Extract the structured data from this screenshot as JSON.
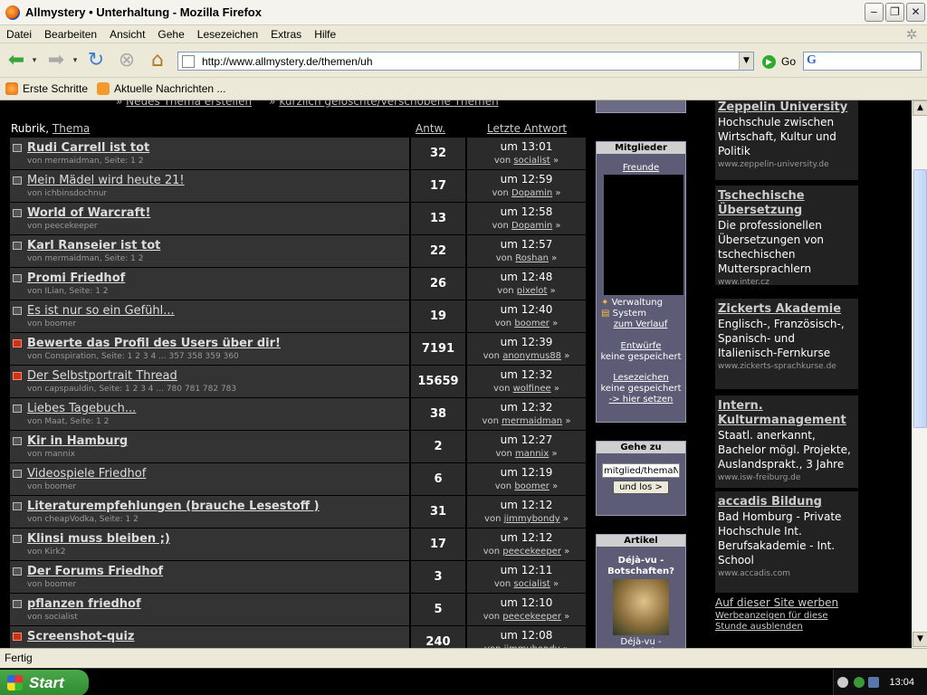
{
  "window": {
    "title": "Allmystery • Unterhaltung - Mozilla Firefox"
  },
  "menu": [
    "Datei",
    "Bearbeiten",
    "Ansicht",
    "Gehe",
    "Lesezeichen",
    "Extras",
    "Hilfe"
  ],
  "nav": {
    "url": "http://www.allmystery.de/themen/uh",
    "go_label": "Go"
  },
  "bookmarks": [
    {
      "label": "Erste Schritte",
      "color": "#e26a12"
    },
    {
      "label": "Aktuelle Nachrichten ...",
      "color": "#f29a2e"
    }
  ],
  "forum": {
    "top_links": {
      "new_topic": "Neues Thema erstellen",
      "deleted": "kürzlich gelöschte/verschobene Themen"
    },
    "header": {
      "rubrik": "Rubrik,",
      "thema": "Thema",
      "antw": "Antw.",
      "last": "Letzte Antwort"
    },
    "threads": [
      {
        "title": "Rudi Carrell ist tot",
        "bold": true,
        "hot": false,
        "sub": "von mermaidman, Seite: 1 2",
        "replies": "32",
        "time": "um 13:01",
        "by": "von",
        "user": "socialist",
        "arrow": "»"
      },
      {
        "title": "Mein Mädel wird heute 21!",
        "bold": false,
        "hot": false,
        "sub": "von ichbinsdochnur",
        "replies": "17",
        "time": "um 12:59",
        "by": "von",
        "user": "Dopamin",
        "arrow": "»"
      },
      {
        "title": "World of Warcraft!",
        "bold": true,
        "hot": false,
        "sub": "von peecekeeper",
        "replies": "13",
        "time": "um 12:58",
        "by": "von",
        "user": "Dopamin",
        "arrow": "»"
      },
      {
        "title": "Karl Ranseier ist tot",
        "bold": true,
        "hot": false,
        "sub": "von mermaidman, Seite: 1 2",
        "replies": "22",
        "time": "um 12:57",
        "by": "von",
        "user": "Roshan",
        "arrow": "»"
      },
      {
        "title": "Promi Friedhof",
        "bold": true,
        "hot": false,
        "sub": "von ILian, Seite: 1 2",
        "replies": "26",
        "time": "um 12:48",
        "by": "von",
        "user": "pixelot",
        "arrow": "»"
      },
      {
        "title": "Es ist nur so ein Gefühl...",
        "bold": false,
        "hot": false,
        "sub": "von boomer",
        "replies": "19",
        "time": "um 12:40",
        "by": "von",
        "user": "boomer",
        "arrow": "»"
      },
      {
        "title": "Bewerte das Profil des Users über dir!",
        "bold": true,
        "hot": true,
        "sub": "von Conspiration, Seite: 1 2 3 4 ... 357 358 359 360",
        "replies": "7191",
        "time": "um 12:39",
        "by": "von",
        "user": "anonymus88",
        "arrow": "»"
      },
      {
        "title": "Der Selbstportrait Thread",
        "bold": false,
        "hot": true,
        "sub": "von capspauldin, Seite: 1 2 3 4 ... 780 781 782 783",
        "replies": "15659",
        "time": "um 12:32",
        "by": "von",
        "user": "wolfinee",
        "arrow": "»"
      },
      {
        "title": "Liebes Tagebuch...",
        "bold": false,
        "hot": false,
        "sub": "von Maat, Seite: 1 2",
        "replies": "38",
        "time": "um 12:32",
        "by": "von",
        "user": "mermaidman",
        "arrow": "»"
      },
      {
        "title": "Kir in Hamburg",
        "bold": true,
        "hot": false,
        "sub": "von mannix",
        "replies": "2",
        "time": "um 12:27",
        "by": "von",
        "user": "mannix",
        "arrow": "»"
      },
      {
        "title": "Videospiele Friedhof",
        "bold": false,
        "hot": false,
        "sub": "von boomer",
        "replies": "6",
        "time": "um 12:19",
        "by": "von",
        "user": "boomer",
        "arrow": "»"
      },
      {
        "title": "Literaturempfehlungen (brauche Lesestoff )",
        "bold": true,
        "hot": false,
        "sub": "von cheapVodka, Seite: 1 2",
        "replies": "31",
        "time": "um 12:12",
        "by": "von",
        "user": "jimmybondy",
        "arrow": "»"
      },
      {
        "title": "Klinsi muss bleiben ;)",
        "bold": true,
        "hot": false,
        "sub": "von Kirk2",
        "replies": "17",
        "time": "um 12:12",
        "by": "von",
        "user": "peecekeeper",
        "arrow": "»"
      },
      {
        "title": "Der Forums Friedhof",
        "bold": true,
        "hot": false,
        "sub": "von boomer",
        "replies": "3",
        "time": "um 12:11",
        "by": "von",
        "user": "socialist",
        "arrow": "»"
      },
      {
        "title": "pflanzen friedhof",
        "bold": true,
        "hot": false,
        "sub": "von socialist",
        "replies": "5",
        "time": "um 12:10",
        "by": "von",
        "user": "peecekeeper",
        "arrow": "»"
      },
      {
        "title": "Screenshot-quiz",
        "bold": true,
        "hot": true,
        "sub": "",
        "replies": "240",
        "time": "um 12:08",
        "by": "von",
        "user": "jimmybondy",
        "arrow": "»"
      }
    ]
  },
  "sidebar": {
    "mitglieder": {
      "title": "Mitglieder",
      "freunde": "Freunde",
      "verwaltung": "Verwaltung",
      "system": "System",
      "verlauf": "zum Verlauf",
      "entwuerfe": "Entwürfe",
      "entwuerfe_status": "keine gespeichert",
      "lesezeichen": "Lesezeichen",
      "lesezeichen_status": "keine gespeichert",
      "setzen": "-> hier setzen"
    },
    "gehezu": {
      "title": "Gehe zu",
      "input_value": "mitglied/themaNR",
      "button": "und los >"
    },
    "artikel": {
      "title": "Artikel",
      "heading": "Déjà-vu - Botschaften?",
      "caption": "Déjà-vu - Botschaften"
    }
  },
  "ads": [
    {
      "title": "Zeppelin University",
      "body": "Hochschule zwischen Wirtschaft, Kultur und Politik",
      "url": "www.zeppelin-university.de"
    },
    {
      "title": "Tschechische Übersetzung",
      "body": "Die professionellen Übersetzungen von tschechischen Muttersprachlern",
      "url": "www.inter.cz"
    },
    {
      "title": "Zickerts Akademie",
      "body": "Englisch-, Französisch-, Spanisch- und Italienisch-Fernkurse",
      "url": "www.zickerts-sprachkurse.de"
    },
    {
      "title": "Intern. Kulturmanagement",
      "body": "Staatl. anerkannt, Bachelor mögl. Projekte, Auslandsprakt., 3 Jahre",
      "url": "www.isw-freiburg.de"
    },
    {
      "title": "accadis Bildung",
      "body": "Bad Homburg - Private Hochschule Int. Berufsakademie - Int. School",
      "url": "www.accadis.com"
    }
  ],
  "adfoot": {
    "werben": "Auf dieser Site werben",
    "ausblenden": "Werbeanzeigen für diese Stunde ausblenden"
  },
  "status": "Fertig",
  "taskbar": {
    "start": "Start",
    "clock": "13:04"
  }
}
